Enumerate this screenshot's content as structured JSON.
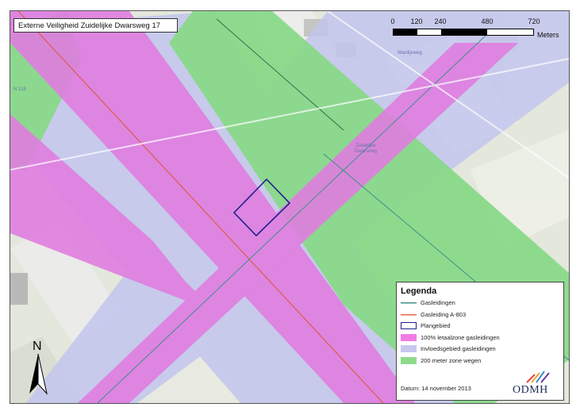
{
  "map": {
    "title": "Externe Veiligheid Zuidelijke Dwarsweg 17",
    "scale": {
      "ticks": [
        "0",
        "120",
        "240",
        "480",
        "720"
      ],
      "unit": "Meters"
    },
    "place_labels": [
      "Wardijsweg",
      "Zuidelijke Dwarsweg",
      "N 215"
    ],
    "north_label": "N"
  },
  "legend": {
    "title": "Legenda",
    "items": [
      {
        "label": "Gasleidingen",
        "kind": "line",
        "color": "#3d8f8a"
      },
      {
        "label": "Gasleiding A-803",
        "kind": "line",
        "color": "#e06a4c"
      },
      {
        "label": "Plangebied",
        "kind": "outline",
        "color": "#1f1f8c"
      },
      {
        "label": "100% letaalzone gasleidingen",
        "kind": "fill",
        "color": "#f07de6"
      },
      {
        "label": "Invloedsgebied gasleidingen",
        "kind": "fill",
        "color": "#c8c8ef"
      },
      {
        "label": "200 meter zone wegen",
        "kind": "fill",
        "color": "#8edc8a"
      }
    ],
    "date": "Datum: 14 november 2013"
  },
  "logo": {
    "text": "ODMH"
  },
  "colors": {
    "lethal": "#e27ce0",
    "influence": "#c5c7ee",
    "road_zone": "#86d884",
    "plan_outline": "#1f1f8c",
    "background": "#e6eadf"
  }
}
